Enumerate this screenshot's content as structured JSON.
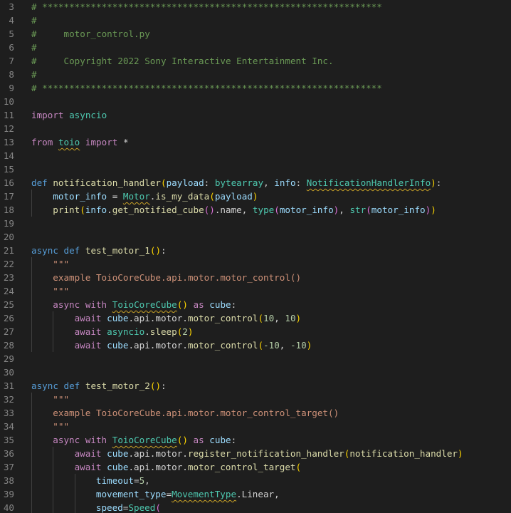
{
  "editor": {
    "file_name": "motor_control.py",
    "lines": [
      {
        "n": "3",
        "i": 0,
        "t": [
          {
            "c": "cm",
            "s": "# ***************************************************************"
          }
        ]
      },
      {
        "n": "4",
        "i": 0,
        "t": [
          {
            "c": "cm",
            "s": "#"
          }
        ]
      },
      {
        "n": "5",
        "i": 0,
        "t": [
          {
            "c": "cm",
            "s": "#     motor_control.py"
          }
        ]
      },
      {
        "n": "6",
        "i": 0,
        "t": [
          {
            "c": "cm",
            "s": "#"
          }
        ]
      },
      {
        "n": "7",
        "i": 0,
        "t": [
          {
            "c": "cm",
            "s": "#     Copyright 2022 Sony Interactive Entertainment Inc."
          }
        ]
      },
      {
        "n": "8",
        "i": 0,
        "t": [
          {
            "c": "cm",
            "s": "#"
          }
        ]
      },
      {
        "n": "9",
        "i": 0,
        "t": [
          {
            "c": "cm",
            "s": "# ***************************************************************"
          }
        ]
      },
      {
        "n": "10",
        "i": 0,
        "t": []
      },
      {
        "n": "11",
        "i": 0,
        "t": [
          {
            "c": "kw",
            "s": "import"
          },
          {
            "c": "",
            "s": " "
          },
          {
            "c": "cls",
            "s": "asyncio"
          }
        ]
      },
      {
        "n": "12",
        "i": 0,
        "t": []
      },
      {
        "n": "13",
        "i": 0,
        "t": [
          {
            "c": "kw",
            "s": "from"
          },
          {
            "c": "",
            "s": " "
          },
          {
            "c": "cls sq",
            "s": "toio"
          },
          {
            "c": "",
            "s": " "
          },
          {
            "c": "kw",
            "s": "import"
          },
          {
            "c": "",
            "s": " *"
          }
        ]
      },
      {
        "n": "14",
        "i": 0,
        "t": []
      },
      {
        "n": "15",
        "i": 0,
        "t": []
      },
      {
        "n": "16",
        "i": 0,
        "t": [
          {
            "c": "def",
            "s": "def"
          },
          {
            "c": "",
            "s": " "
          },
          {
            "c": "fn",
            "s": "notification_handler"
          },
          {
            "c": "p1",
            "s": "("
          },
          {
            "c": "var",
            "s": "payload"
          },
          {
            "c": "",
            "s": ": "
          },
          {
            "c": "cls",
            "s": "bytearray"
          },
          {
            "c": "",
            "s": ", "
          },
          {
            "c": "var",
            "s": "info"
          },
          {
            "c": "",
            "s": ": "
          },
          {
            "c": "cls sq",
            "s": "NotificationHandlerInfo"
          },
          {
            "c": "p1",
            "s": ")"
          },
          {
            "c": "",
            "s": ":"
          }
        ]
      },
      {
        "n": "17",
        "i": 1,
        "t": [
          {
            "c": "var",
            "s": "motor_info"
          },
          {
            "c": "",
            "s": " = "
          },
          {
            "c": "cls sq",
            "s": "Motor"
          },
          {
            "c": "",
            "s": "."
          },
          {
            "c": "fn",
            "s": "is_my_data"
          },
          {
            "c": "p1",
            "s": "("
          },
          {
            "c": "var",
            "s": "payload"
          },
          {
            "c": "p1",
            "s": ")"
          }
        ]
      },
      {
        "n": "18",
        "i": 1,
        "t": [
          {
            "c": "fn",
            "s": "print"
          },
          {
            "c": "p1",
            "s": "("
          },
          {
            "c": "var",
            "s": "info"
          },
          {
            "c": "",
            "s": "."
          },
          {
            "c": "fn",
            "s": "get_notified_cube"
          },
          {
            "c": "p2",
            "s": "()"
          },
          {
            "c": "",
            "s": ".name, "
          },
          {
            "c": "cls",
            "s": "type"
          },
          {
            "c": "p2",
            "s": "("
          },
          {
            "c": "var",
            "s": "motor_info"
          },
          {
            "c": "p2",
            "s": ")"
          },
          {
            "c": "",
            "s": ", "
          },
          {
            "c": "cls",
            "s": "str"
          },
          {
            "c": "p2",
            "s": "("
          },
          {
            "c": "var",
            "s": "motor_info"
          },
          {
            "c": "p2",
            "s": ")"
          },
          {
            "c": "p1",
            "s": ")"
          }
        ]
      },
      {
        "n": "19",
        "i": 0,
        "t": []
      },
      {
        "n": "20",
        "i": 0,
        "t": []
      },
      {
        "n": "21",
        "i": 0,
        "t": [
          {
            "c": "def",
            "s": "async"
          },
          {
            "c": "",
            "s": " "
          },
          {
            "c": "def",
            "s": "def"
          },
          {
            "c": "",
            "s": " "
          },
          {
            "c": "fn",
            "s": "test_motor_1"
          },
          {
            "c": "p1",
            "s": "()"
          },
          {
            "c": "",
            "s": ":"
          }
        ]
      },
      {
        "n": "22",
        "i": 1,
        "t": [
          {
            "c": "str",
            "s": "\"\"\""
          }
        ]
      },
      {
        "n": "23",
        "i": 1,
        "t": [
          {
            "c": "str",
            "s": "example ToioCoreCube.api.motor.motor_control()"
          }
        ]
      },
      {
        "n": "24",
        "i": 1,
        "t": [
          {
            "c": "str",
            "s": "\"\"\""
          }
        ]
      },
      {
        "n": "25",
        "i": 1,
        "t": [
          {
            "c": "kw",
            "s": "async"
          },
          {
            "c": "",
            "s": " "
          },
          {
            "c": "kw",
            "s": "with"
          },
          {
            "c": "",
            "s": " "
          },
          {
            "c": "cls sq",
            "s": "ToioCoreCube"
          },
          {
            "c": "p1",
            "s": "()"
          },
          {
            "c": "",
            "s": " "
          },
          {
            "c": "kw",
            "s": "as"
          },
          {
            "c": "",
            "s": " "
          },
          {
            "c": "var",
            "s": "cube"
          },
          {
            "c": "",
            "s": ":"
          }
        ]
      },
      {
        "n": "26",
        "i": 2,
        "t": [
          {
            "c": "kw",
            "s": "await"
          },
          {
            "c": "",
            "s": " "
          },
          {
            "c": "var",
            "s": "cube"
          },
          {
            "c": "",
            "s": ".api.motor."
          },
          {
            "c": "fn",
            "s": "motor_control"
          },
          {
            "c": "p1",
            "s": "("
          },
          {
            "c": "num",
            "s": "10"
          },
          {
            "c": "",
            "s": ", "
          },
          {
            "c": "num",
            "s": "10"
          },
          {
            "c": "p1",
            "s": ")"
          }
        ]
      },
      {
        "n": "27",
        "i": 2,
        "t": [
          {
            "c": "kw",
            "s": "await"
          },
          {
            "c": "",
            "s": " "
          },
          {
            "c": "cls",
            "s": "asyncio"
          },
          {
            "c": "",
            "s": "."
          },
          {
            "c": "fn",
            "s": "sleep"
          },
          {
            "c": "p1",
            "s": "("
          },
          {
            "c": "num",
            "s": "2"
          },
          {
            "c": "p1",
            "s": ")"
          }
        ]
      },
      {
        "n": "28",
        "i": 2,
        "t": [
          {
            "c": "kw",
            "s": "await"
          },
          {
            "c": "",
            "s": " "
          },
          {
            "c": "var",
            "s": "cube"
          },
          {
            "c": "",
            "s": ".api.motor."
          },
          {
            "c": "fn",
            "s": "motor_control"
          },
          {
            "c": "p1",
            "s": "("
          },
          {
            "c": "num",
            "s": "-10"
          },
          {
            "c": "",
            "s": ", "
          },
          {
            "c": "num",
            "s": "-10"
          },
          {
            "c": "p1",
            "s": ")"
          }
        ]
      },
      {
        "n": "29",
        "i": 0,
        "t": []
      },
      {
        "n": "30",
        "i": 0,
        "t": []
      },
      {
        "n": "31",
        "i": 0,
        "t": [
          {
            "c": "def",
            "s": "async"
          },
          {
            "c": "",
            "s": " "
          },
          {
            "c": "def",
            "s": "def"
          },
          {
            "c": "",
            "s": " "
          },
          {
            "c": "fn",
            "s": "test_motor_2"
          },
          {
            "c": "p1",
            "s": "()"
          },
          {
            "c": "",
            "s": ":"
          }
        ]
      },
      {
        "n": "32",
        "i": 1,
        "t": [
          {
            "c": "str",
            "s": "\"\"\""
          }
        ]
      },
      {
        "n": "33",
        "i": 1,
        "t": [
          {
            "c": "str",
            "s": "example ToioCoreCube.api.motor.motor_control_target()"
          }
        ]
      },
      {
        "n": "34",
        "i": 1,
        "t": [
          {
            "c": "str",
            "s": "\"\"\""
          }
        ]
      },
      {
        "n": "35",
        "i": 1,
        "t": [
          {
            "c": "kw",
            "s": "async"
          },
          {
            "c": "",
            "s": " "
          },
          {
            "c": "kw",
            "s": "with"
          },
          {
            "c": "",
            "s": " "
          },
          {
            "c": "cls sq",
            "s": "ToioCoreCube"
          },
          {
            "c": "p1",
            "s": "()"
          },
          {
            "c": "",
            "s": " "
          },
          {
            "c": "kw",
            "s": "as"
          },
          {
            "c": "",
            "s": " "
          },
          {
            "c": "var",
            "s": "cube"
          },
          {
            "c": "",
            "s": ":"
          }
        ]
      },
      {
        "n": "36",
        "i": 2,
        "t": [
          {
            "c": "kw",
            "s": "await"
          },
          {
            "c": "",
            "s": " "
          },
          {
            "c": "var",
            "s": "cube"
          },
          {
            "c": "",
            "s": ".api.motor."
          },
          {
            "c": "fn",
            "s": "register_notification_handler"
          },
          {
            "c": "p1",
            "s": "("
          },
          {
            "c": "fn",
            "s": "notification_handler"
          },
          {
            "c": "p1",
            "s": ")"
          }
        ]
      },
      {
        "n": "37",
        "i": 2,
        "t": [
          {
            "c": "kw",
            "s": "await"
          },
          {
            "c": "",
            "s": " "
          },
          {
            "c": "var",
            "s": "cube"
          },
          {
            "c": "",
            "s": ".api.motor."
          },
          {
            "c": "fn",
            "s": "motor_control_target"
          },
          {
            "c": "p1",
            "s": "("
          }
        ]
      },
      {
        "n": "38",
        "i": 3,
        "t": [
          {
            "c": "var",
            "s": "timeout"
          },
          {
            "c": "",
            "s": "="
          },
          {
            "c": "num",
            "s": "5"
          },
          {
            "c": "",
            "s": ","
          }
        ]
      },
      {
        "n": "39",
        "i": 3,
        "t": [
          {
            "c": "var",
            "s": "movement_type"
          },
          {
            "c": "",
            "s": "="
          },
          {
            "c": "cls sq",
            "s": "MovementType"
          },
          {
            "c": "",
            "s": ".Linear,"
          }
        ]
      },
      {
        "n": "40",
        "i": 3,
        "t": [
          {
            "c": "var",
            "s": "speed"
          },
          {
            "c": "",
            "s": "="
          },
          {
            "c": "cls sq",
            "s": "Speed"
          },
          {
            "c": "p2",
            "s": "("
          }
        ]
      }
    ]
  }
}
